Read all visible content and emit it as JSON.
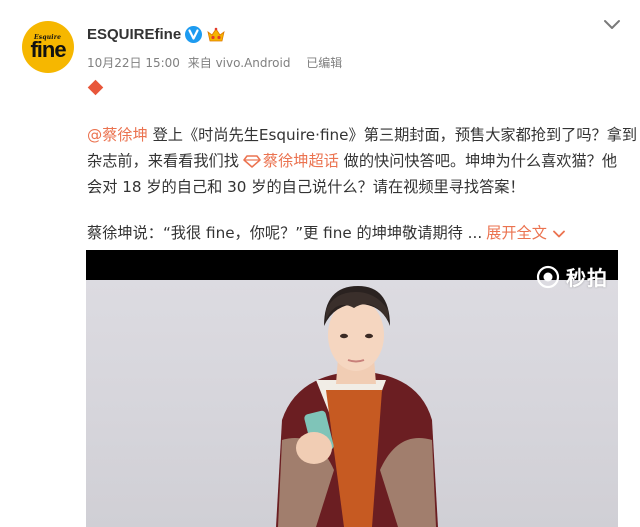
{
  "author": {
    "avatar_text_small": "Esquire",
    "avatar_text_big": "fine",
    "name": "ESQUIREfine"
  },
  "meta": {
    "date": "10月22日 15:00",
    "source": "来自 vivo.Android",
    "edited": "已编辑"
  },
  "post": {
    "mention": "@蔡徐坤",
    "line1_rest": " 登上《时尚先生Esquire·fine》第三期封面，预售大家都抢到了吗？拿到",
    "line2_before": "杂志前，来看看我们找",
    "topic": "蔡徐坤超话",
    "line2_after": " 做的快问快答吧。坤坤为什么喜欢猫？他",
    "line3": "会对 18 岁的自己和 30 岁的自己说什么？请在视频里寻找答案！",
    "quote": "蔡徐坤说：“我很 fine，你呢？”更 fine 的坤坤敬请期待 ...",
    "expand_label": "展开全文"
  },
  "video": {
    "watermark": "秒拍"
  },
  "colors": {
    "accent": "#eb7350",
    "verified": "#1d9bf0",
    "avatar_bg": "#f6b700",
    "diamond": "#e8563a"
  },
  "icons": {
    "verified": "verified-badge-icon",
    "vip": "vip-crown-icon",
    "collapse": "chevron-down-icon",
    "topic": "topic-diamond-icon",
    "expand": "chevron-down-icon",
    "watermark": "miaopai-logo-icon"
  }
}
